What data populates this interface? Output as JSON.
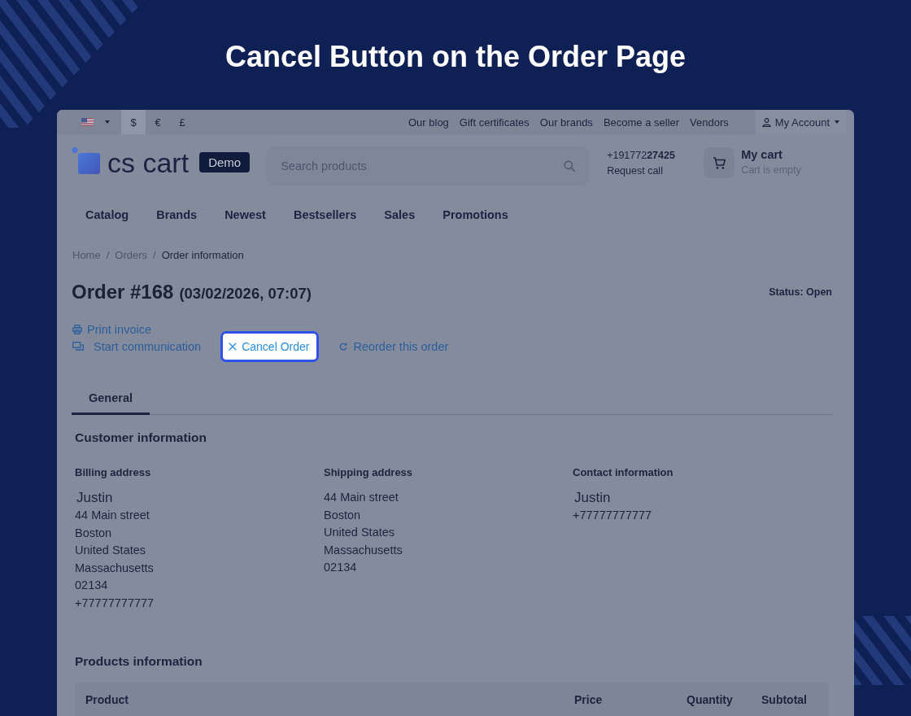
{
  "heading": {
    "title": "Cancel Button on the Order Page"
  },
  "top_bar": {
    "currencies": [
      {
        "label": "$",
        "selected": true
      },
      {
        "label": "€",
        "selected": false
      },
      {
        "label": "£",
        "selected": false
      }
    ],
    "links": [
      "Our blog",
      "Gift certificates",
      "Our brands",
      "Become a seller",
      "Vendors"
    ],
    "account": {
      "label": "My Account"
    }
  },
  "header": {
    "logo": {
      "text": "cs cart",
      "badge": "Demo"
    },
    "search": {
      "placeholder": "Search products"
    },
    "phone": {
      "number": "+191772**27425**",
      "action": "Request call"
    },
    "cart": {
      "title": "My cart",
      "status": "Cart is empty"
    }
  },
  "nav": [
    "Catalog",
    "Brands",
    "Newest",
    "Bestsellers",
    "Sales",
    "Promotions"
  ],
  "breadcrumb": {
    "separator": "/",
    "items": [
      {
        "label": "Home",
        "current": false
      },
      {
        "label": "Orders",
        "current": false
      },
      {
        "label": "Order information",
        "current": true
      }
    ]
  },
  "order": {
    "title": "Order #168",
    "date": "(03/02/2026, 07:07)",
    "status": "Status: Open"
  },
  "action_rows": [
    [
      {
        "kind": "print",
        "label": "Print invoice",
        "highlighted": false
      }
    ],
    [
      {
        "kind": "communication",
        "label": "Start communication",
        "highlighted": false
      },
      {
        "kind": "cancel",
        "label": "Cancel Order",
        "highlighted": true
      },
      {
        "kind": "reorder",
        "label": "Reorder this order",
        "highlighted": false
      }
    ]
  ],
  "tabs": [
    {
      "label": "General",
      "selected": true
    }
  ],
  "customer_information": {
    "title": "Customer information",
    "columns": [
      {
        "heading": "Billing address",
        "name": "Justin",
        "lines": [
          "44 Main street",
          "Boston",
          "United States",
          "Massachusetts",
          "02134",
          "+77777777777"
        ]
      },
      {
        "heading": "Shipping address",
        "lines": [
          "44 Main street",
          "Boston",
          "United States",
          "Massachusetts",
          "02134"
        ]
      },
      {
        "heading": "Contact information",
        "name": "Justin",
        "lines": [
          "+77777777777"
        ]
      }
    ]
  },
  "products_information": {
    "title": "Products information",
    "columns": [
      "Product",
      "Price",
      "Quantity",
      "Subtotal"
    ]
  }
}
